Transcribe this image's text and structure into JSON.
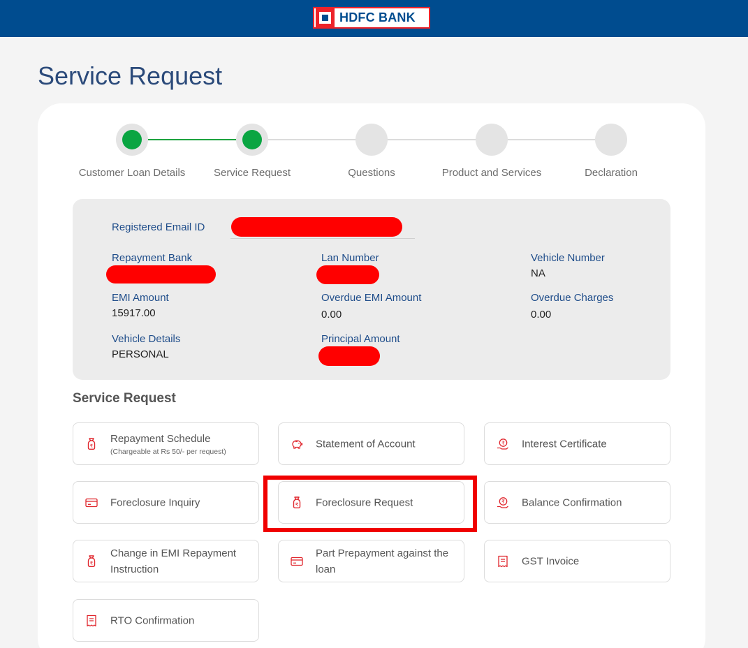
{
  "header": {
    "brand": "HDFC BANK"
  },
  "page": {
    "title": "Service Request"
  },
  "stepper": {
    "steps": [
      {
        "label": "Customer Loan Details",
        "state": "completed"
      },
      {
        "label": "Service Request",
        "state": "current"
      },
      {
        "label": "Questions",
        "state": "pending"
      },
      {
        "label": "Product and Services",
        "state": "pending"
      },
      {
        "label": "Declaration",
        "state": "pending"
      }
    ]
  },
  "loan_details": {
    "registered_email": {
      "label": "Registered Email ID",
      "value": ""
    },
    "repayment_bank": {
      "label": "Repayment Bank",
      "value": ""
    },
    "lan_number": {
      "label": "Lan Number",
      "value": ""
    },
    "vehicle_number": {
      "label": "Vehicle Number",
      "value": "NA"
    },
    "emi_amount": {
      "label": "EMI Amount",
      "value": "15917.00"
    },
    "overdue_emi_amount": {
      "label": "Overdue EMI Amount",
      "value": "0.00"
    },
    "overdue_charges": {
      "label": "Overdue Charges",
      "value": "0.00"
    },
    "vehicle_details": {
      "label": "Vehicle Details",
      "value": "PERSONAL"
    },
    "principal_amount": {
      "label": "Principal Amount",
      "value": ""
    }
  },
  "service_request": {
    "heading": "Service Request",
    "tiles": [
      {
        "label": "Repayment Schedule",
        "note": "(Chargeable at Rs 50/- per request)",
        "icon": "money-bag-icon"
      },
      {
        "label": "Statement of Account",
        "icon": "piggy-bank-icon"
      },
      {
        "label": "Interest Certificate",
        "icon": "rupee-hand-icon"
      },
      {
        "label": "Foreclosure Inquiry",
        "icon": "card-icon"
      },
      {
        "label": "Foreclosure Request",
        "icon": "money-bag-icon"
      },
      {
        "label": "Balance Confirmation",
        "icon": "rupee-hand-icon"
      },
      {
        "label": "Change in EMI Repayment Instruction",
        "icon": "money-bag-icon"
      },
      {
        "label": "Part Prepayment against the loan",
        "icon": "card-icon"
      },
      {
        "label": "GST Invoice",
        "icon": "document-icon"
      },
      {
        "label": "RTO Confirmation",
        "icon": "document-icon"
      }
    ]
  },
  "colors": {
    "brand_blue": "#004c8f",
    "brand_red": "#ed232a",
    "step_done": "#0aa542",
    "icon_red": "#e0262d",
    "highlight": "#f00000"
  }
}
